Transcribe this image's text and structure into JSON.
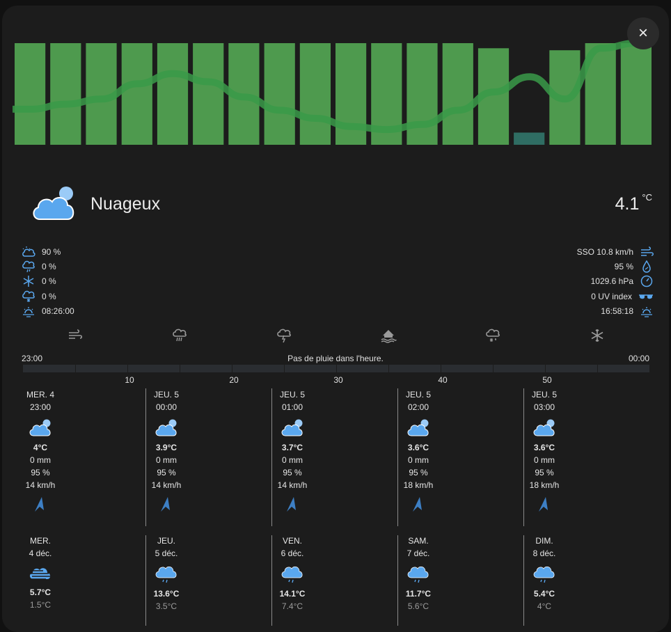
{
  "close_label": "×",
  "condition": {
    "text": "Nuageux",
    "icon": "partly-cloudy-icon"
  },
  "temperature": {
    "value": "4.1",
    "unit": "°C"
  },
  "left_attributes": [
    {
      "icon": "cloud-coverage-icon",
      "value": "90 %"
    },
    {
      "icon": "rain-probability-icon",
      "value": "0 %"
    },
    {
      "icon": "frost-icon",
      "value": "0 %"
    },
    {
      "icon": "snow-probability-icon",
      "value": "0 %"
    },
    {
      "icon": "sunrise-icon",
      "value": "08:26:00"
    }
  ],
  "right_attributes": [
    {
      "icon": "wind-icon",
      "value": "SSO 10.8 km/h"
    },
    {
      "icon": "humidity-icon",
      "value": "95 %"
    },
    {
      "icon": "pressure-gauge-icon",
      "value": "1029.6 hPa"
    },
    {
      "icon": "sunglasses-icon",
      "value": "0 UV index"
    },
    {
      "icon": "sunset-icon",
      "value": "16:58:18"
    }
  ],
  "action_icons": [
    "wind-action-icon",
    "rain-action-icon",
    "storm-action-icon",
    "flood-action-icon",
    "snow-cloud-action-icon",
    "snowflake-action-icon"
  ],
  "rain_forecast": {
    "start": "23:00",
    "text": "Pas de pluie dans l'heure.",
    "end": "00:00",
    "ticks": [
      "10",
      "20",
      "30",
      "40",
      "50"
    ]
  },
  "hourly": [
    {
      "day": "MER. 4",
      "time": "23:00",
      "temp": "4°C",
      "rain": "0 mm",
      "humidity": "95 %",
      "wind": "14 km/h"
    },
    {
      "day": "JEU. 5",
      "time": "00:00",
      "temp": "3.9°C",
      "rain": "0 mm",
      "humidity": "95 %",
      "wind": "14 km/h"
    },
    {
      "day": "JEU. 5",
      "time": "01:00",
      "temp": "3.7°C",
      "rain": "0 mm",
      "humidity": "95 %",
      "wind": "14 km/h"
    },
    {
      "day": "JEU. 5",
      "time": "02:00",
      "temp": "3.6°C",
      "rain": "0 mm",
      "humidity": "95 %",
      "wind": "18 km/h"
    },
    {
      "day": "JEU. 5",
      "time": "03:00",
      "temp": "3.6°C",
      "rain": "0 mm",
      "humidity": "95 %",
      "wind": "18 km/h"
    }
  ],
  "daily": [
    {
      "day": "MER.",
      "date": "4 déc.",
      "icon": "fog-icon",
      "high": "5.7°C",
      "low": "1.5°C"
    },
    {
      "day": "JEU.",
      "date": "5 déc.",
      "icon": "light-rain-icon",
      "high": "13.6°C",
      "low": "3.5°C"
    },
    {
      "day": "VEN.",
      "date": "6 déc.",
      "icon": "light-rain-icon",
      "high": "14.1°C",
      "low": "7.4°C"
    },
    {
      "day": "SAM.",
      "date": "7 déc.",
      "icon": "light-rain-icon",
      "high": "11.7°C",
      "low": "5.6°C"
    },
    {
      "day": "DIM.",
      "date": "8 déc.",
      "icon": "light-rain-icon",
      "high": "5.4°C",
      "low": "4°C"
    }
  ],
  "colors": {
    "bar": "#4e9a4e",
    "line": "#3a9a49",
    "icon_blue": "#5aa7ee",
    "wind_arrow": "#3d7fc4",
    "background": "#1c1c1c"
  },
  "chart_data": {
    "type": "bar",
    "series": [
      {
        "values": [
          1,
          1,
          1,
          1,
          1,
          1,
          1,
          1,
          1,
          1,
          1,
          1,
          1,
          0.95,
          0.12,
          0.93,
          1,
          1
        ]
      },
      {
        "values": [
          0.35,
          0.4,
          0.45,
          0.6,
          0.7,
          0.62,
          0.47,
          0.34,
          0.26,
          0.18,
          0.15,
          0.2,
          0.34,
          0.52,
          0.67,
          0.45,
          0.95,
          1
        ]
      }
    ]
  }
}
